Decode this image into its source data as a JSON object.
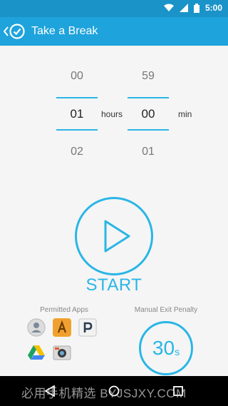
{
  "status": {
    "time": "5:00"
  },
  "appbar": {
    "title": "Take a Break"
  },
  "picker": {
    "hours": {
      "prev": "00",
      "value": "01",
      "next": "02",
      "unit": "hours"
    },
    "minutes": {
      "prev": "59",
      "value": "00",
      "next": "01",
      "unit": "min"
    }
  },
  "start": {
    "label": "START"
  },
  "permitted": {
    "label": "Permitted Apps",
    "apps": [
      "contacts-app-icon",
      "ak-app-icon",
      "p-app-icon",
      "drive-app-icon",
      "camera-app-icon"
    ]
  },
  "penalty": {
    "label": "Manual Exit Penalty",
    "value": "30",
    "unit": "s"
  },
  "watermark": "必用手机精选 BYJSJXY.COM",
  "colors": {
    "accent": "#29b6e6",
    "appbar": "#1fa3dc",
    "statusbar": "#1a93c9"
  }
}
